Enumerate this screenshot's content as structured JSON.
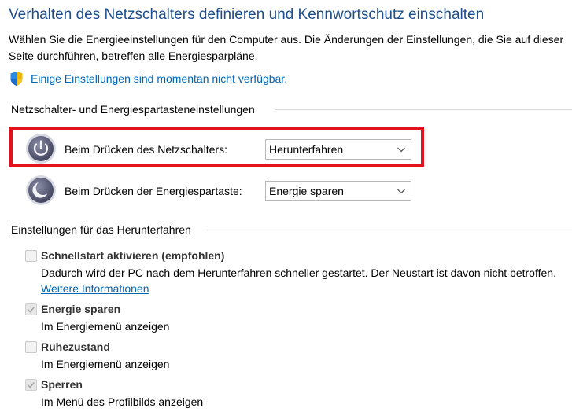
{
  "header": {
    "title": "Verhalten des Netzschalters definieren und Kennwortschutz einschalten",
    "description": "Wählen Sie die Energieeinstellungen für den Computer aus. Die Änderungen der Einstellungen, die Sie auf dieser Seite durchführen, betreffen alle Energiesparpläne.",
    "notice_link": "Einige Einstellungen sind momentan nicht verfügbar."
  },
  "button_settings": {
    "heading": "Netzschalter- und Energiespartasteneinstellungen",
    "power_button": {
      "label": "Beim Drücken des Netzschalters:",
      "value": "Herunterfahren",
      "icon": "power-icon"
    },
    "sleep_button": {
      "label": "Beim Drücken der Energiespartaste:",
      "value": "Energie sparen",
      "icon": "sleep-icon"
    }
  },
  "shutdown_settings": {
    "heading": "Einstellungen für das Herunterfahren",
    "items": [
      {
        "label": "Schnellstart aktivieren (empfohlen)",
        "checked": false,
        "desc": "Dadurch wird der PC nach dem Herunterfahren schneller gestartet. Der Neustart ist davon nicht betroffen.",
        "link": "Weitere Informationen"
      },
      {
        "label": "Energie sparen",
        "checked": true,
        "desc": "Im Energiemenü anzeigen"
      },
      {
        "label": "Ruhezustand",
        "checked": false,
        "desc": "Im Energiemenü anzeigen"
      },
      {
        "label": "Sperren",
        "checked": true,
        "desc": "Im Menü des Profilbilds anzeigen"
      }
    ]
  },
  "colors": {
    "title": "#1e4e8c",
    "link": "#0066b4",
    "highlight": "#e3121c"
  }
}
